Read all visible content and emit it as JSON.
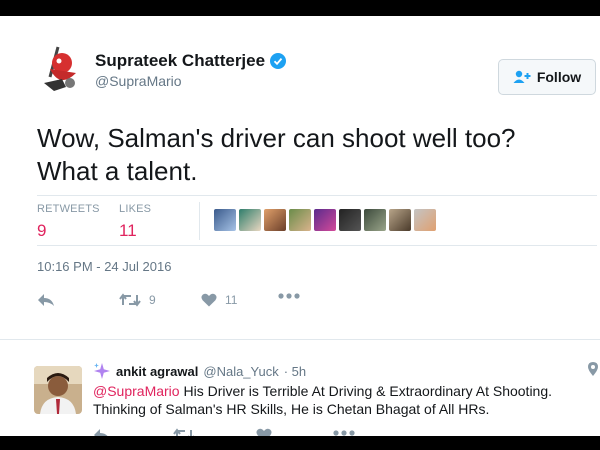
{
  "tweet": {
    "display_name": "Suprateek Chatterjee",
    "handle": "@SupraMario",
    "follow_label": "Follow",
    "text_line1": "Wow, Salman's driver can shoot well too?",
    "text_line2": "What a talent.",
    "retweets_label": "RETWEETS",
    "retweets_count": "9",
    "likes_label": "LIKES",
    "likes_count": "11",
    "timestamp": "10:16 PM - 24 Jul 2016",
    "action_retweet_count": "9",
    "action_like_count": "11"
  },
  "reply": {
    "display_name": "ankit agrawal",
    "handle": "@Nala_Yuck",
    "time": "· 5h",
    "mention": "@SupraMario",
    "text_rest": " His Driver is Terrible At Driving & Extraordinary At Shooting. Thinking of Salman's HR Skills, He is Chetan Bhagat of All HRs."
  },
  "colors": {
    "accent": "#1da1f2",
    "like_red": "#e0245e",
    "muted": "#657786"
  }
}
